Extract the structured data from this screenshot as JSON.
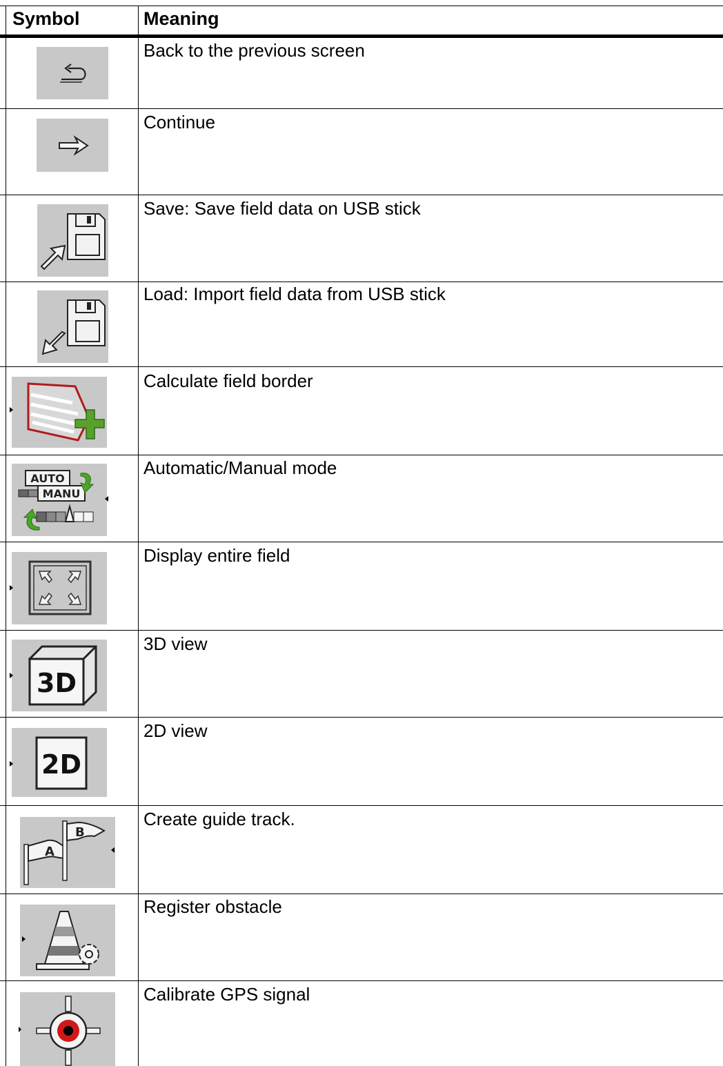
{
  "table": {
    "header": {
      "symbol": "Symbol",
      "meaning": "Meaning"
    },
    "rows": [
      {
        "icon": "back-icon",
        "meaning": "Back to the previous screen"
      },
      {
        "icon": "continue-icon",
        "meaning": "Continue"
      },
      {
        "icon": "save-usb-icon",
        "meaning": "Save: Save field data on USB stick"
      },
      {
        "icon": "load-usb-icon",
        "meaning": "Load: Import field data from USB stick"
      },
      {
        "icon": "field-border-add-icon",
        "meaning": "Calculate field border"
      },
      {
        "icon": "auto-manual-icon",
        "meaning": "Automatic/Manual mode",
        "icon_text": [
          "AUTO",
          "MANU"
        ]
      },
      {
        "icon": "display-field-icon",
        "meaning": "Display entire field"
      },
      {
        "icon": "view-3d-icon",
        "meaning": "3D view",
        "icon_text": "3D"
      },
      {
        "icon": "view-2d-icon",
        "meaning": "2D view",
        "icon_text": "2D"
      },
      {
        "icon": "guide-track-flags-icon",
        "meaning": "Create guide track.",
        "icon_text": [
          "A",
          "B"
        ]
      },
      {
        "icon": "obstacle-cone-icon",
        "meaning": "Register obstacle"
      },
      {
        "icon": "gps-target-icon",
        "meaning": "Calibrate GPS signal"
      }
    ]
  },
  "colors": {
    "icon_bg": "#c8c8c8",
    "field_red": "#b01c1c",
    "plus_green": "#5aa02c",
    "arrow_green": "#4aa52a",
    "gps_red": "#d01818"
  }
}
